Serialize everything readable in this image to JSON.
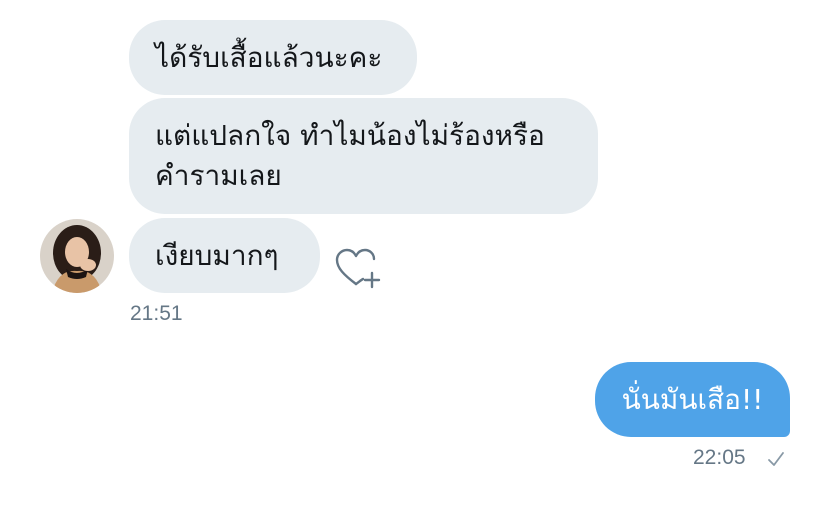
{
  "incoming_messages": [
    {
      "text": "ได้รับเสื้อแล้วนะคะ"
    },
    {
      "text": "แต่แปลกใจ ทำไมน้องไม่ร้องหรือคำรามเลย"
    },
    {
      "text": "เงียบมากๆ"
    }
  ],
  "incoming_time": "21:51",
  "outgoing_message": {
    "text": "นั่นมันเสือ!!"
  },
  "outgoing_time": "22:05",
  "icons": {
    "like": "heart-plus-icon",
    "sent_status": "checkmark-icon",
    "avatar": "user-avatar"
  },
  "colors": {
    "incoming_bubble": "#e6ecf0",
    "outgoing_bubble": "#4fa3e8",
    "timestamp": "#657786"
  }
}
